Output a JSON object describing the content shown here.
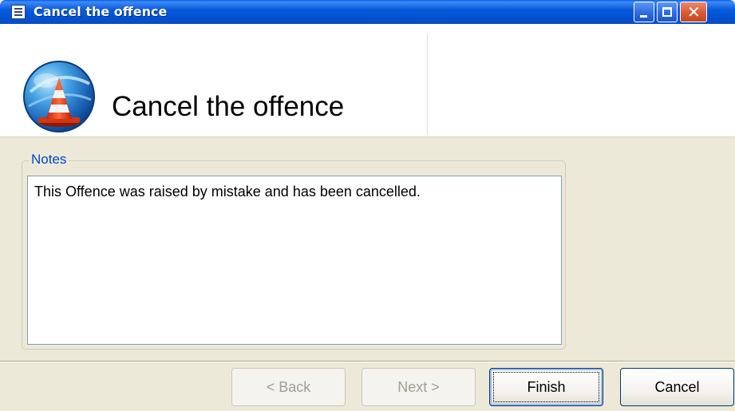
{
  "window": {
    "title": "Cancel the offence",
    "icon": "form-icon",
    "controls": {
      "minimize_icon": "minimize-icon",
      "maximize_icon": "maximize-icon",
      "close_icon": "close-icon",
      "close_glyph": "✕"
    }
  },
  "header": {
    "title": "Cancel the offence",
    "logo_icon": "traffic-cone-globe-icon"
  },
  "notes": {
    "legend": "Notes",
    "value": "This Offence was raised by mistake and has been cancelled."
  },
  "buttons": {
    "back": "< Back",
    "next": "Next >",
    "finish": "Finish",
    "cancel": "Cancel"
  },
  "colors": {
    "titlebar": "#0253d3",
    "legend_text": "#0046d5",
    "dialog_bg": "#ece9d8"
  }
}
